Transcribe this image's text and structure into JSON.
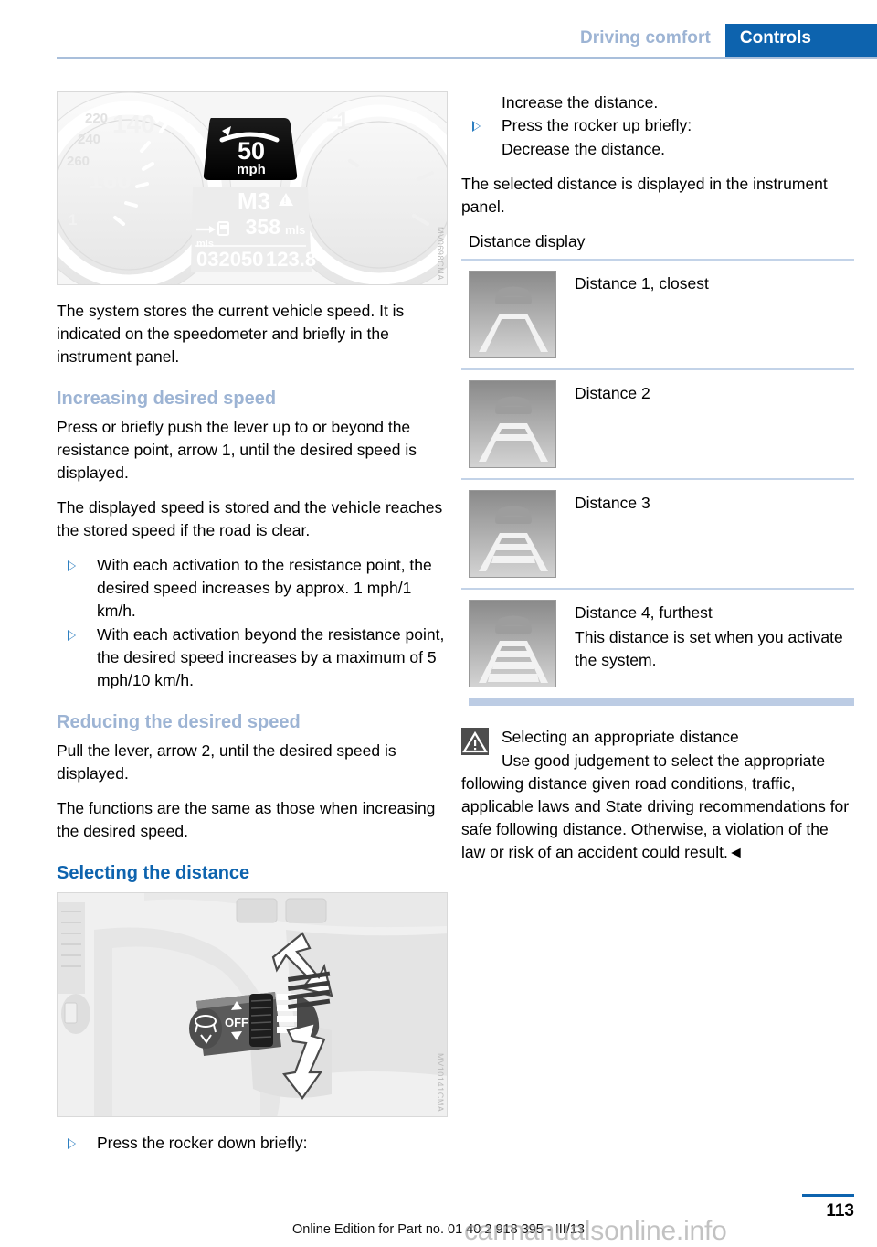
{
  "header": {
    "chapter": "Driving comfort",
    "section": "Controls"
  },
  "figures": {
    "cluster": {
      "code": "MV0698CMA",
      "speed_value": "50",
      "speed_unit": "mph",
      "gear": "M3",
      "range_value": "358",
      "range_unit": "mls",
      "odometer": "032050",
      "trip": "123.8",
      "trip_unit": "mls",
      "dial_ticks": [
        "220",
        "240",
        "260",
        "140",
        "160",
        "1"
      ],
      "right_dial_tick": "1"
    },
    "lever": {
      "code": "MV10141CMA",
      "off_label": "OFF"
    }
  },
  "left_column": {
    "intro_paragraph": "The system stores the current vehicle speed. It is indicated on the speedometer and briefly in the instrument panel.",
    "heading_increasing": "Increasing desired speed",
    "increasing_p1": "Press or briefly push the lever up to or beyond the resistance point, arrow 1, until the desired speed is displayed.",
    "increasing_p2": "The displayed speed is stored and the vehicle reaches the stored speed if the road is clear.",
    "increasing_bullets": [
      "With each activation to the resistance point, the desired speed increases by approx. 1 mph/1 km/h.",
      "With each activation beyond the resistance point, the desired speed increases by a maximum of 5 mph/10 km/h."
    ],
    "heading_reducing": "Reducing the desired speed",
    "reducing_p1": "Pull the lever, arrow 2, until the desired speed is displayed.",
    "reducing_p2": "The functions are the same as those when increasing the desired speed.",
    "heading_selecting": "Selecting the distance",
    "rocker_down_bullet": "Press the rocker down briefly:"
  },
  "right_column": {
    "rocker_down_result": "Increase the distance.",
    "rocker_up_bullet": "Press the rocker up briefly:",
    "rocker_up_result": "Decrease the distance.",
    "selected_distance_paragraph": "The selected distance is displayed in the instrument panel.",
    "distance_display_caption": "Distance display",
    "distance_rows": [
      {
        "label": "Distance 1, closest",
        "note": "",
        "bars": 1
      },
      {
        "label": "Distance 2",
        "note": "",
        "bars": 2
      },
      {
        "label": "Distance 3",
        "note": "",
        "bars": 3
      },
      {
        "label": "Distance 4, furthest",
        "note": "This distance is set when you activate the system.",
        "bars": 4
      }
    ],
    "warning": {
      "icon": "warning-triangle-icon",
      "title": "Selecting an appropriate distance",
      "body": "Use good judgement to select the appropriate following distance given road conditions, traffic, applicable laws and State driving recommendations for safe following distance. Otherwise, a violation of the law or risk of an accident could result.◄"
    }
  },
  "footer": {
    "edition_text": "Online Edition for Part no. 01 40 2 918 395 - III/13",
    "page_number": "113",
    "watermark": "carmanualsonline.info"
  },
  "colors": {
    "accent_blue": "#0d63ae",
    "muted_blue": "#9db4d4",
    "rule_blue": "#c3d3e8"
  }
}
